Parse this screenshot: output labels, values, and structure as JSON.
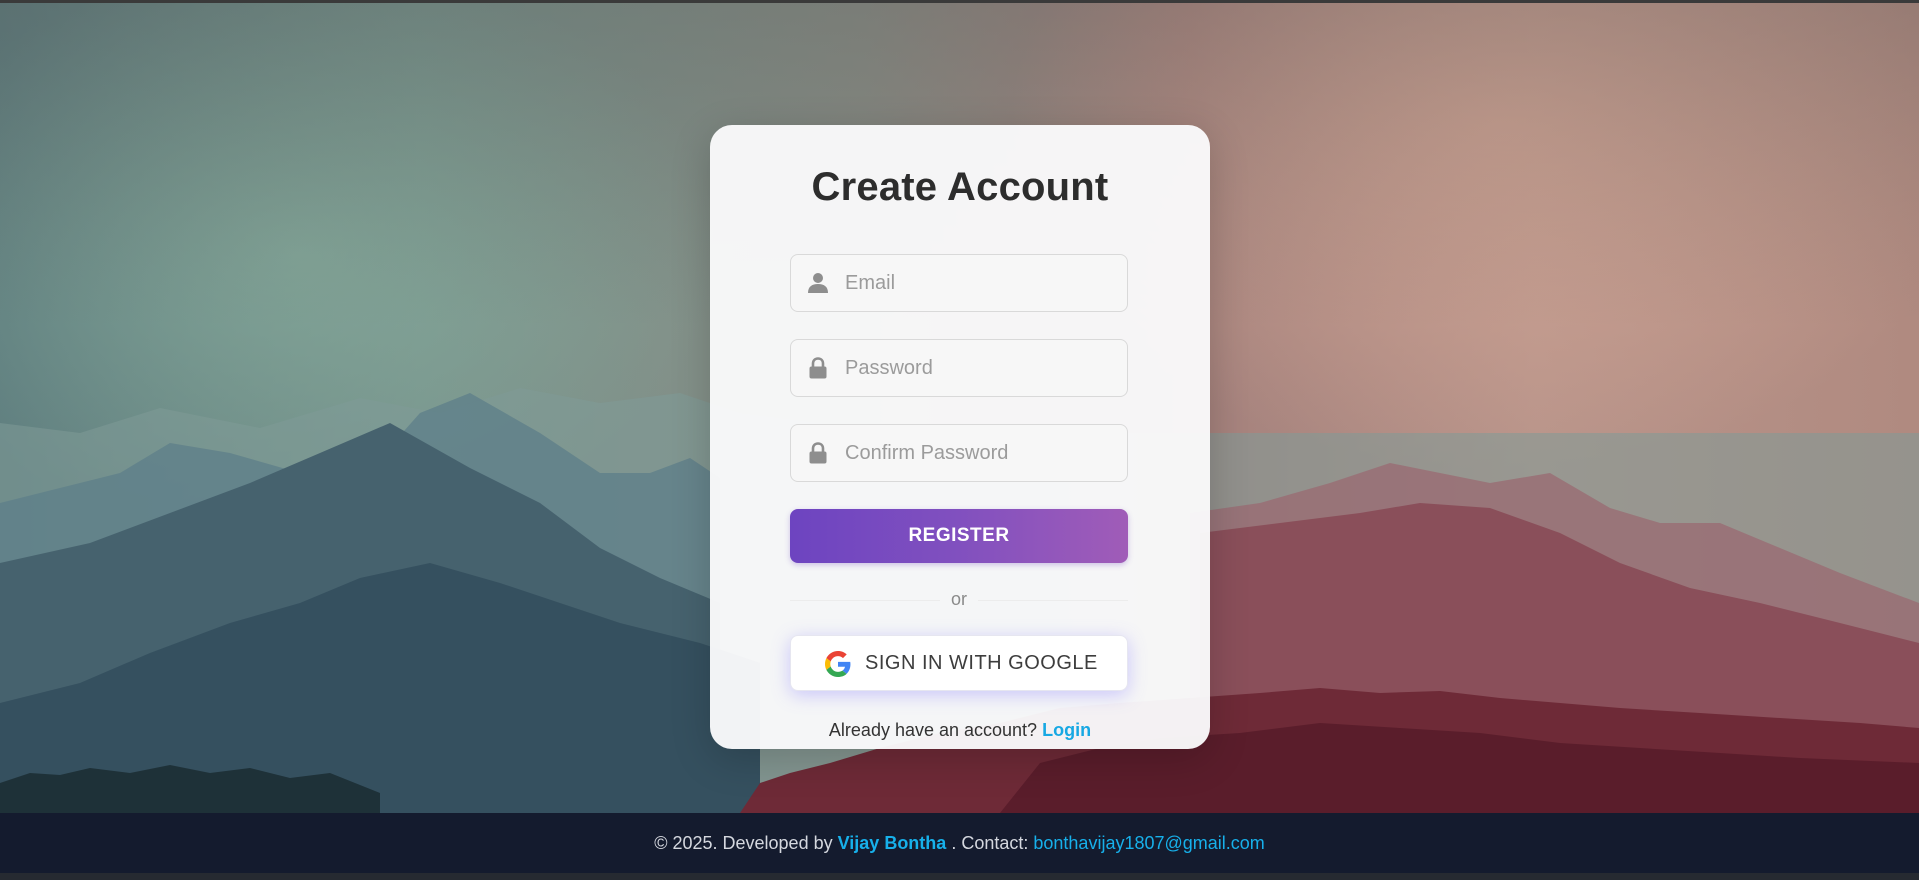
{
  "card": {
    "title": "Create Account",
    "fields": [
      {
        "placeholder": "Email",
        "icon": "user-icon",
        "value": ""
      },
      {
        "placeholder": "Password",
        "icon": "lock-icon",
        "value": ""
      },
      {
        "placeholder": "Confirm Password",
        "icon": "lock-icon",
        "value": ""
      }
    ],
    "register_label": "REGISTER",
    "divider_text": "or",
    "google_label": "SIGN IN WITH GOOGLE",
    "google_icon": "google-icon",
    "login_prompt": "Already have an account?",
    "login_link": "Login"
  },
  "footer": {
    "prefix": "© 2025. Developed by",
    "developer": "Vijay Bontha",
    "contact_label": ". Contact:",
    "email": "bonthavijay1807@gmail.com"
  },
  "colors": {
    "register_start": "#6d44c0",
    "register_end": "#a05cb8",
    "link": "#17a8e3",
    "footer_bg": "#141b2e",
    "title": "#2d2d2d"
  }
}
